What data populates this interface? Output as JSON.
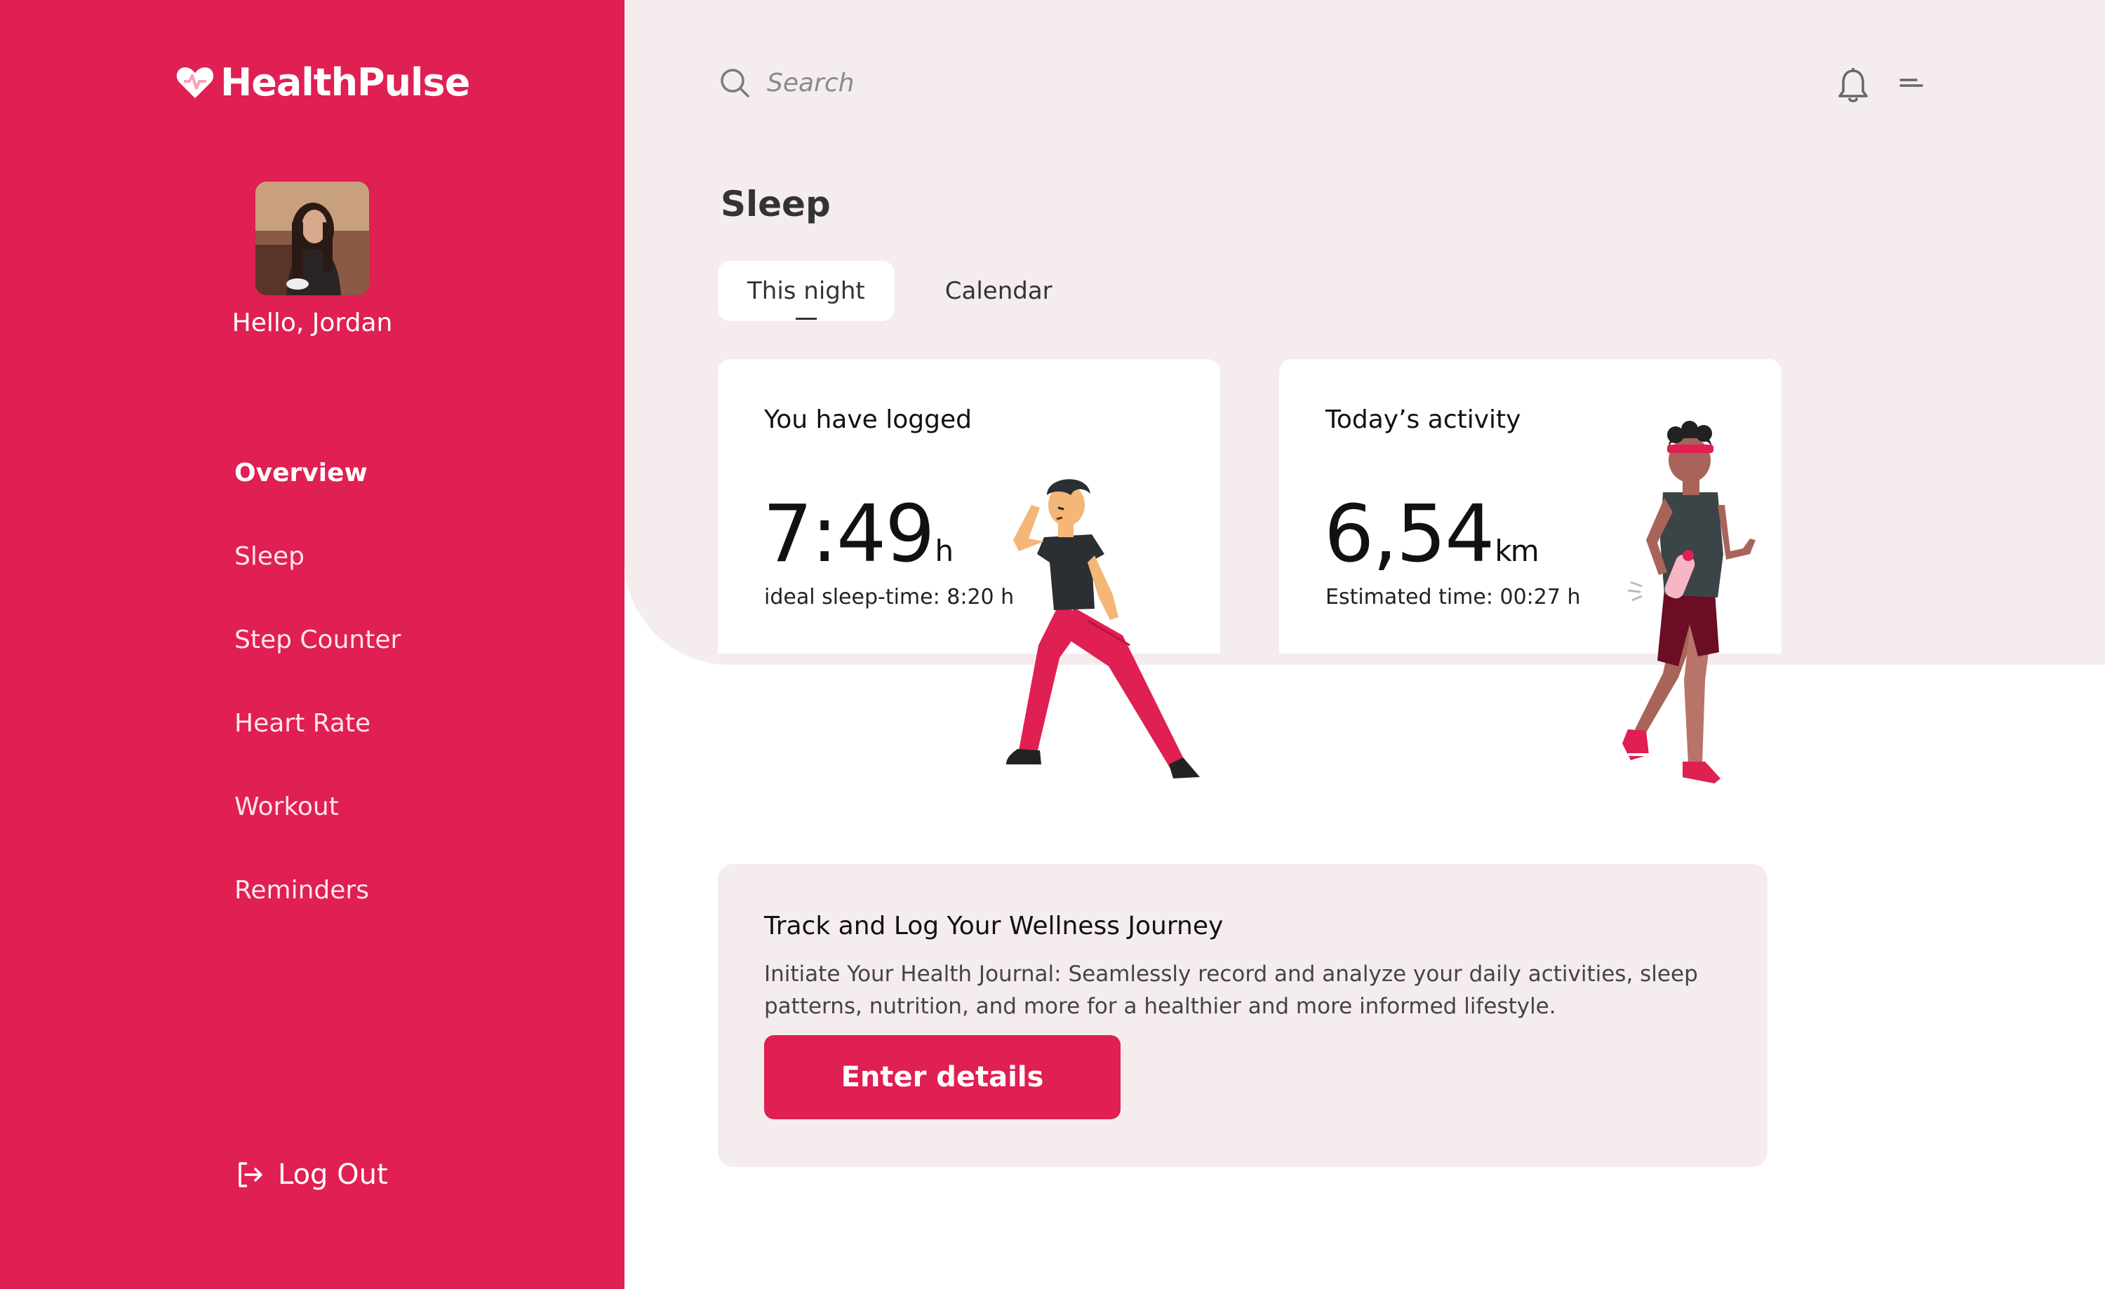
{
  "app": {
    "name": "HealthPulse"
  },
  "colors": {
    "accent": "#e01f52",
    "panel": "#f5ecee"
  },
  "user": {
    "greeting": "Hello, Jordan"
  },
  "sidebar": {
    "items": [
      {
        "label": "Overview",
        "active": true
      },
      {
        "label": "Sleep",
        "active": false
      },
      {
        "label": "Step Counter",
        "active": false
      },
      {
        "label": "Heart Rate",
        "active": false
      },
      {
        "label": "Workout",
        "active": false
      },
      {
        "label": "Reminders",
        "active": false
      }
    ],
    "logout_label": "Log Out"
  },
  "header": {
    "search_placeholder": "Search",
    "icons": [
      "search-icon",
      "bell-icon",
      "menu-icon"
    ]
  },
  "main": {
    "title": "Sleep",
    "tabs": [
      {
        "label": "This night",
        "active": true
      },
      {
        "label": "Calendar",
        "active": false
      }
    ],
    "sleep_card": {
      "title": "You have logged",
      "value": "7:49",
      "unit": "h",
      "sub": "ideal sleep-time: 8:20 h"
    },
    "activity_card": {
      "title": "Today’s activity",
      "value": "6,54",
      "unit": "km",
      "sub": "Estimated time: 00:27 h"
    },
    "banner": {
      "title": "Track and Log Your Wellness Journey",
      "text": "Initiate Your Health Journal: Seamlessly record and analyze your daily activities, sleep patterns, nutrition, and more for a healthier and more informed lifestyle.",
      "button_label": "Enter details"
    }
  }
}
